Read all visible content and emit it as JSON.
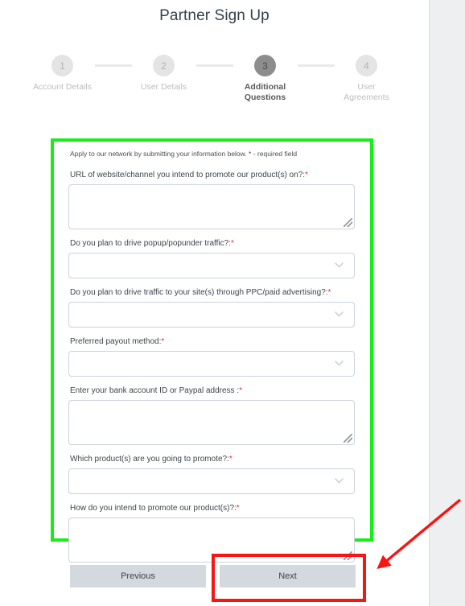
{
  "page": {
    "title": "Partner Sign Up"
  },
  "stepper": {
    "steps": [
      {
        "number": "1",
        "label": "Account Details",
        "active": false
      },
      {
        "number": "2",
        "label": "User Details",
        "active": false
      },
      {
        "number": "3",
        "label": "Additional Questions",
        "active": true
      },
      {
        "number": "4",
        "label": "User Agreements",
        "active": false
      }
    ]
  },
  "form": {
    "intro": "Apply to our network by submitting your information below. * - required field",
    "required_marker": "*",
    "fields": [
      {
        "label": "URL of website/channel you intend to promote our product(s) on?:",
        "required": true,
        "type": "textarea",
        "value": ""
      },
      {
        "label": "Do you plan to drive popup/popunder traffic?:",
        "required": true,
        "type": "select",
        "value": ""
      },
      {
        "label": "Do you plan to drive traffic to your site(s) through PPC/paid advertising?:",
        "required": true,
        "type": "select",
        "value": ""
      },
      {
        "label": "Preferred payout method:",
        "required": true,
        "type": "select",
        "value": ""
      },
      {
        "label": "Enter your bank account ID or Paypal address :",
        "required": true,
        "type": "textarea",
        "value": ""
      },
      {
        "label": "Which product(s) are you going to promote?:",
        "required": true,
        "type": "select",
        "value": ""
      },
      {
        "label": "How do you intend to promote our product(s)?:",
        "required": true,
        "type": "textarea",
        "value": ""
      }
    ]
  },
  "footer": {
    "previous_label": "Previous",
    "next_label": "Next"
  },
  "annotations": {
    "highlight_box_color": "#14f014",
    "callout_box_color": "#f81414",
    "arrow_color": "#f81414",
    "highlight_target": "additional-questions-form",
    "callout_target": "next-button"
  }
}
